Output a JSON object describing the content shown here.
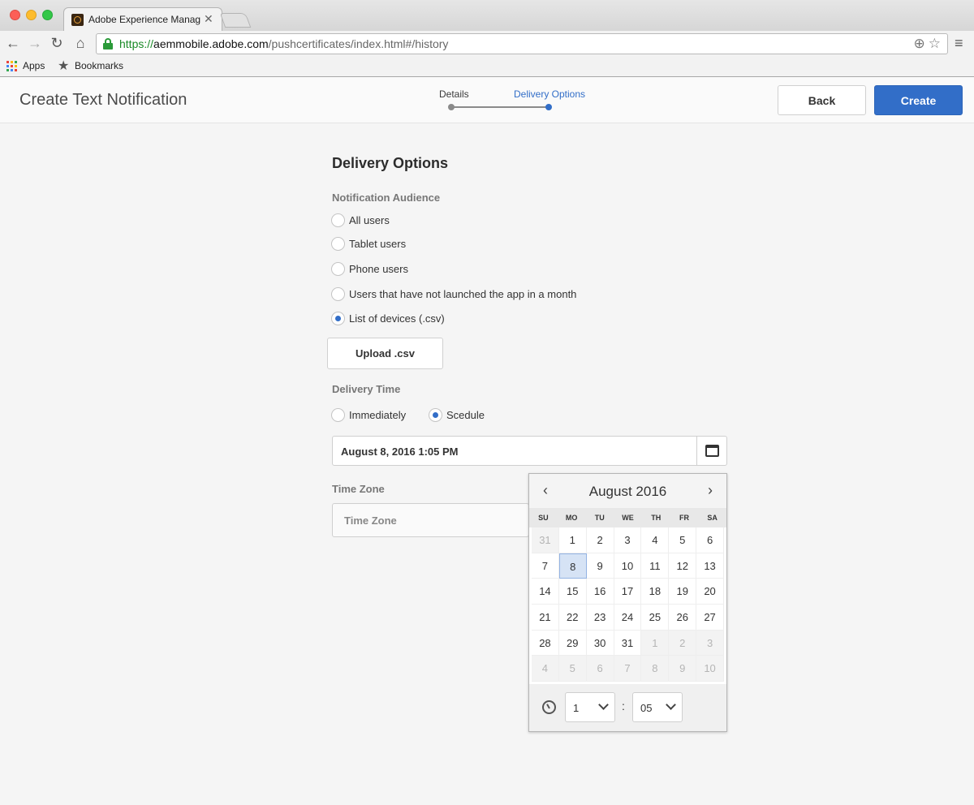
{
  "browser": {
    "tab_title": "Adobe Experience Manager",
    "tab_close": "✕",
    "url_scheme": "https://",
    "url_host": "aemmobile.adobe.com",
    "url_path": "/pushcertificates/index.html#/history",
    "bookmarks": {
      "apps": "Apps",
      "bookmarks": "Bookmarks"
    },
    "icons": {
      "back": "←",
      "forward": "→",
      "reload": "↻",
      "home": "⌂",
      "zoom": "⊕",
      "star": "☆",
      "menu": "≡",
      "bookmark_star": "★"
    }
  },
  "header": {
    "title": "Create Text Notification",
    "steps": [
      {
        "label": "Details"
      },
      {
        "label": "Delivery Options"
      }
    ],
    "back_label": "Back",
    "create_label": "Create",
    "accent_color": "#326ec8"
  },
  "form": {
    "section_title": "Delivery Options",
    "audience_label": "Notification Audience",
    "audience_options": [
      {
        "label": "All users",
        "checked": false
      },
      {
        "label": "Tablet users",
        "checked": false
      },
      {
        "label": "Phone users",
        "checked": false
      },
      {
        "label": "Users that have not launched the app in a month",
        "checked": false
      },
      {
        "label": "List of devices (.csv)",
        "checked": true
      }
    ],
    "upload_label": "Upload .csv",
    "delivery_time_label": "Delivery Time",
    "delivery_options": [
      {
        "label": "Immediately",
        "checked": false
      },
      {
        "label": "Scedule",
        "checked": true
      }
    ],
    "date_value": "August 8, 2016 1:05 PM",
    "timezone_label": "Time Zone",
    "timezone_placeholder": "Time Zone"
  },
  "datepicker": {
    "month_label": "August 2016",
    "prev": "‹",
    "next": "›",
    "weekdays": [
      "SU",
      "MO",
      "TU",
      "WE",
      "TH",
      "FR",
      "SA"
    ],
    "weeks": [
      [
        "31",
        "1",
        "2",
        "3",
        "4",
        "5",
        "6"
      ],
      [
        "7",
        "8",
        "9",
        "10",
        "11",
        "12",
        "13"
      ],
      [
        "14",
        "15",
        "16",
        "17",
        "18",
        "19",
        "20"
      ],
      [
        "21",
        "22",
        "23",
        "24",
        "25",
        "26",
        "27"
      ],
      [
        "28",
        "29",
        "30",
        "31",
        "1",
        "2",
        "3"
      ],
      [
        "4",
        "5",
        "6",
        "7",
        "8",
        "9",
        "10"
      ]
    ],
    "selected_day": "8",
    "hour": "1",
    "minute": "05",
    "colon": ":"
  }
}
